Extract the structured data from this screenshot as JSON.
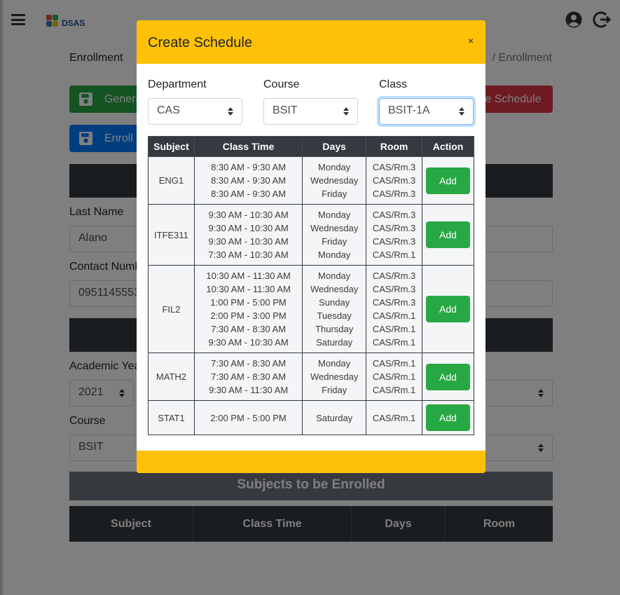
{
  "topbar": {
    "logo_text": "DSAS"
  },
  "background": {
    "breadcrumb_left": "Enrollment",
    "breadcrumb_right": "/ Enrollment",
    "generate_button": "Genera",
    "enroll_button": "Enroll",
    "create_schedule_button": "te Schedule",
    "last_name_label": "Last Name",
    "last_name_value": "Alano",
    "contact_label": "Contact Numb",
    "contact_value": "0951145553",
    "academic_year_label": "Academic Yea",
    "academic_year_value": "2021",
    "course_label": "Course",
    "course_value": "BSIT",
    "subjects_bar": "Subjects to be Enrolled",
    "table_headers": [
      "Subject",
      "Class Time",
      "Days",
      "Room"
    ]
  },
  "modal": {
    "title": "Create Schedule",
    "close": "×",
    "department_label": "Department",
    "department_value": "CAS",
    "course_label": "Course",
    "course_value": "BSIT",
    "class_label": "Class",
    "class_value": "BSIT-1A",
    "table_headers": [
      "Subject",
      "Class Time",
      "Days",
      "Room",
      "Action"
    ],
    "add_label": "Add",
    "rows": [
      {
        "subject": "ENG1",
        "times": [
          "8:30 AM - 9:30 AM",
          "8:30 AM - 9:30 AM",
          "8:30 AM - 9:30 AM"
        ],
        "days": [
          "Monday",
          "Wednesday",
          "Friday"
        ],
        "rooms": [
          "CAS/Rm.3",
          "CAS/Rm.3",
          "CAS/Rm.3"
        ]
      },
      {
        "subject": "ITFE311",
        "times": [
          "9:30 AM - 10:30 AM",
          "9:30 AM - 10:30 AM",
          "9:30 AM - 10:30 AM",
          "7:30 AM - 10:30 AM"
        ],
        "days": [
          "Monday",
          "Wednesday",
          "Friday",
          "Monday"
        ],
        "rooms": [
          "CAS/Rm.3",
          "CAS/Rm.3",
          "CAS/Rm.3",
          "CAS/Rm.1"
        ]
      },
      {
        "subject": "FIL2",
        "times": [
          "10:30 AM - 11:30 AM",
          "10:30 AM - 11:30 AM",
          "1:00 PM - 5:00 PM",
          "2:00 PM - 3:00 PM",
          "7:30 AM - 8:30 AM",
          "9:30 AM - 10:30 AM"
        ],
        "days": [
          "Monday",
          "Wednesday",
          "Sunday",
          "Tuesday",
          "Thursday",
          "Saturday"
        ],
        "rooms": [
          "CAS/Rm.3",
          "CAS/Rm.3",
          "CAS/Rm.3",
          "CAS/Rm.1",
          "CAS/Rm.1",
          "CAS/Rm.1"
        ]
      },
      {
        "subject": "MATH2",
        "times": [
          "7:30 AM - 8:30 AM",
          "7:30 AM - 8:30 AM",
          "9:30 AM - 11:30 AM"
        ],
        "days": [
          "Monday",
          "Wednesday",
          "Friday"
        ],
        "rooms": [
          "CAS/Rm.1",
          "CAS/Rm.1",
          "CAS/Rm.1"
        ]
      },
      {
        "subject": "STAT1",
        "times": [
          "2:00 PM - 5:00 PM"
        ],
        "days": [
          "Saturday"
        ],
        "rooms": [
          "CAS/Rm.1"
        ]
      }
    ]
  }
}
